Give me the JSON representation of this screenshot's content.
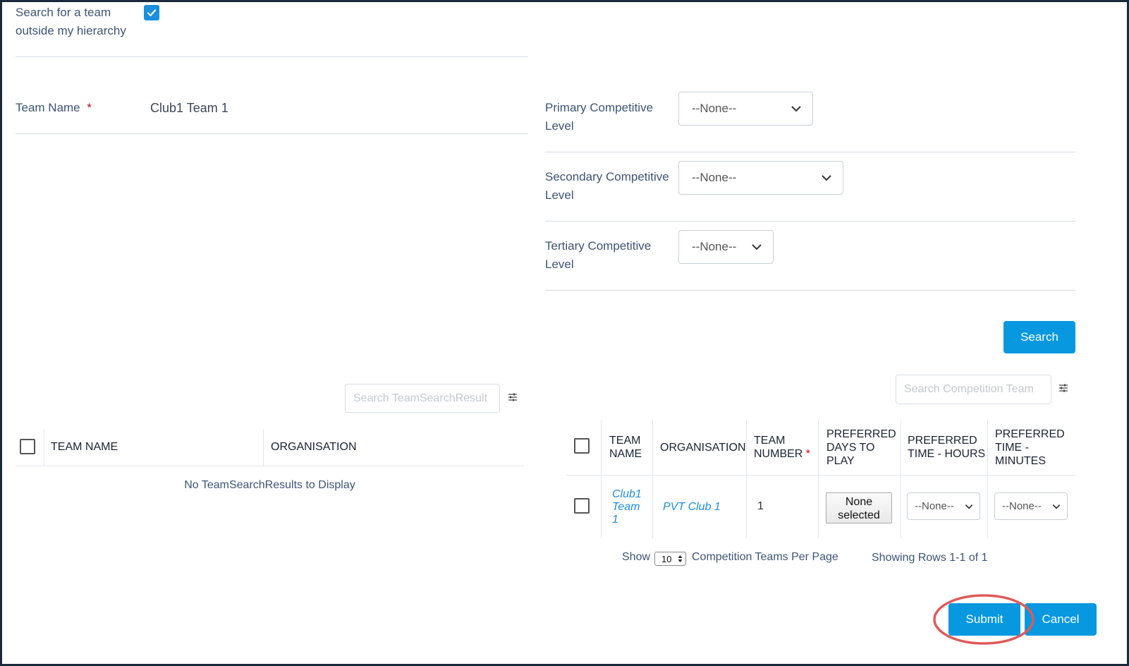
{
  "search_outside": {
    "label_line1": "Search for a team",
    "label_line2": "outside my hierarchy",
    "checked": true
  },
  "team_name": {
    "label": "Team Name",
    "required_mark": "*",
    "value": "Club1 Team 1"
  },
  "levels": {
    "primary": {
      "label_line1": "Primary Competitive",
      "label_line2": "Level",
      "value": "--None--"
    },
    "secondary": {
      "label_line1": "Secondary Competitive",
      "label_line2": "Level",
      "value": "--None--"
    },
    "tertiary": {
      "label_line1": "Tertiary Competitive",
      "label_line2": "Level",
      "value": "--None--"
    }
  },
  "search_button": "Search",
  "results_table": {
    "search_placeholder": "Search TeamSearchResult",
    "columns": [
      "TEAM NAME",
      "ORGANISATION"
    ],
    "empty_message": "No TeamSearchResults to Display"
  },
  "competition_table": {
    "search_placeholder": "Search Competition Team",
    "columns": {
      "team_name_1": "TEAM",
      "team_name_2": "NAME",
      "organisation": "ORGANISATION",
      "team_number_1": "TEAM",
      "team_number_2": "NUMBER",
      "required_mark": "*",
      "days_1": "PREFERRED",
      "days_2": "DAYS TO",
      "days_3": "PLAY",
      "hours_1": "PREFERRED",
      "hours_2": "TIME - HOURS",
      "minutes_1": "PREFERRED",
      "minutes_2": "TIME -",
      "minutes_3": "MINUTES"
    },
    "row": {
      "team_name_1": "Club1",
      "team_name_2": "Team",
      "team_name_3": "1",
      "organisation": "PVT Club 1",
      "team_number": "1",
      "days_line1": "None",
      "days_line2": "selected",
      "hours": "--None--",
      "minutes": "--None--"
    },
    "pager": {
      "show_label": "Show",
      "page_size": "10",
      "per_page_label": "Competition Teams Per Page",
      "rows_info": "Showing Rows 1-1 of 1"
    }
  },
  "footer": {
    "submit": "Submit",
    "cancel": "Cancel"
  },
  "colors": {
    "accent": "#0798e0",
    "label": "#3d5475",
    "required": "#d0021b",
    "highlight_circle": "#e05a5a"
  }
}
